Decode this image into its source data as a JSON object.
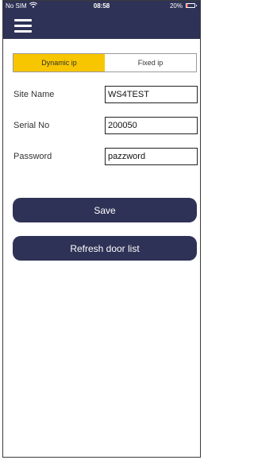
{
  "status_bar": {
    "carrier": "No SIM",
    "wifi_icon": "wifi-icon",
    "time": "08:58",
    "battery_percent": "20%",
    "battery_level": 0.2,
    "battery_color": "#e74c3c"
  },
  "nav": {
    "menu_icon": "hamburger-menu-icon",
    "bar_color": "#2e3256"
  },
  "ip_mode": {
    "options": [
      "Dynamic ip",
      "Fixed ip"
    ],
    "selected": "Dynamic ip",
    "active_color": "#f7c600"
  },
  "form": {
    "site_name_label": "Site Name",
    "site_name_value": "WS4TEST",
    "serial_no_label": "Serial No",
    "serial_no_value": "200050",
    "password_label": "Password",
    "password_value": "pazzword"
  },
  "actions": {
    "save_label": "Save",
    "refresh_label": "Refresh door list"
  }
}
